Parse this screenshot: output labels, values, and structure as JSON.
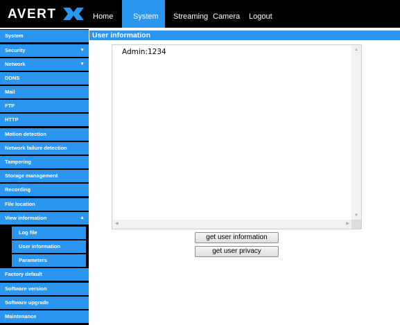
{
  "brand": {
    "logo_text": "AVERTX"
  },
  "nav": {
    "home": "Home",
    "system": "System",
    "streaming": "Streaming",
    "camera": "Camera",
    "logout": "Logout"
  },
  "sidebar": {
    "items": [
      {
        "label": "System"
      },
      {
        "label": "Security"
      },
      {
        "label": "Network"
      },
      {
        "label": "DDNS"
      },
      {
        "label": "Mail"
      },
      {
        "label": "FTP"
      },
      {
        "label": "HTTP"
      },
      {
        "label": "Motion detection"
      },
      {
        "label": "Network failure detection"
      },
      {
        "label": "Tampering"
      },
      {
        "label": "Storage management"
      },
      {
        "label": "Recording"
      },
      {
        "label": "File location"
      },
      {
        "label": "View information"
      }
    ],
    "subitems": [
      {
        "label": "Log file"
      },
      {
        "label": "User information"
      },
      {
        "label": "Parameters"
      }
    ],
    "bottom_items": [
      {
        "label": "Factory default"
      },
      {
        "label": "Software version"
      },
      {
        "label": "Software upgrade"
      },
      {
        "label": "Maintenance"
      }
    ]
  },
  "main": {
    "section_title": "User information",
    "textarea_value": "Admin:1234",
    "buttons": {
      "get_user_information": "get user information",
      "get_user_privacy": "get user privacy"
    }
  },
  "colors": {
    "accent": "#2b96ef",
    "header_bg": "#000000"
  }
}
